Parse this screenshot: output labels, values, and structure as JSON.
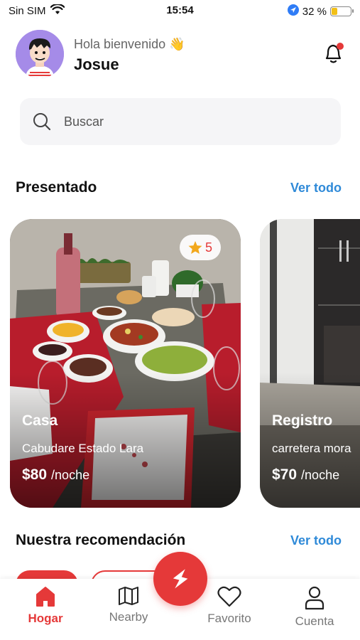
{
  "status_bar": {
    "carrier": "Sin SIM",
    "time": "15:54",
    "battery_percent_text": "32 %",
    "battery_level": 0.32
  },
  "header": {
    "greeting": "Hola bienvenido 👋",
    "username": "Josue",
    "notification_dot_color": "#e53939"
  },
  "search": {
    "placeholder": "Buscar"
  },
  "featured": {
    "title": "Presentado",
    "see_all": "Ver todo",
    "cards": [
      {
        "title": "Casa",
        "location": "Cabudare Estado Lara",
        "price": "$80",
        "per": "/noche",
        "rating": "5"
      },
      {
        "title": "Registro",
        "location": "carretera mora",
        "price": "$70",
        "per": "/noche"
      }
    ]
  },
  "recommendation": {
    "title": "Nuestra recomendación",
    "see_all": "Ver todo"
  },
  "bottom_nav": {
    "items": [
      {
        "label": "Hogar",
        "icon": "home-icon",
        "active": true
      },
      {
        "label": "Nearby",
        "icon": "map-icon",
        "active": false
      },
      {
        "label": "Favorito",
        "icon": "heart-icon",
        "active": false
      },
      {
        "label": "Cuenta",
        "icon": "user-icon",
        "active": false
      }
    ],
    "fab_icon": "lightning-icon"
  },
  "colors": {
    "accent": "#e53939",
    "link": "#2f8ad8",
    "search_bg": "#f5f5f7"
  }
}
